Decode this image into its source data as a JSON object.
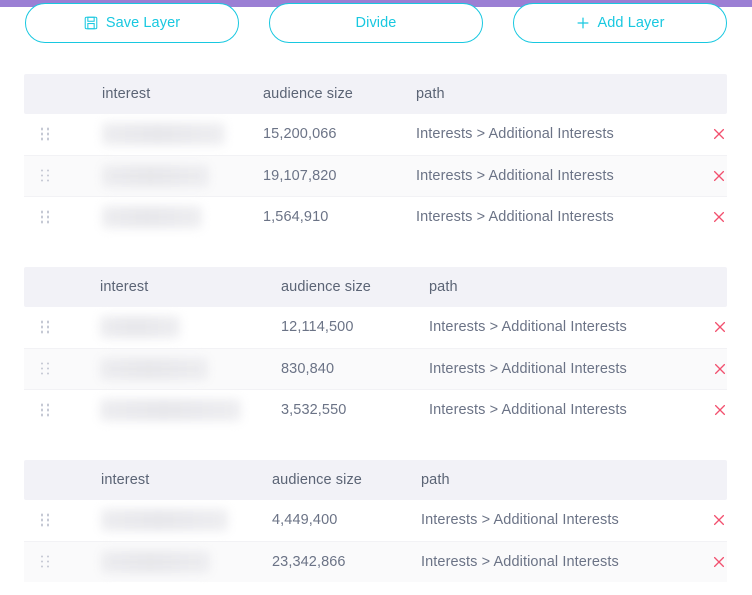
{
  "accent": {
    "top_bar_color": "#9b7fd4",
    "button_color": "#18c8e0",
    "delete_color": "#f2506e",
    "header_bg": "#f2f2f7"
  },
  "toolbar": {
    "save_label": "Save Layer",
    "save_icon": "save-icon",
    "divide_label": "Divide",
    "add_label": "Add Layer",
    "add_icon": "plus-icon"
  },
  "tables": [
    {
      "columns": {
        "interest": "interest",
        "audience": "audience size",
        "path": "path"
      },
      "col_x": {
        "interest": 78,
        "audience": 239,
        "path": 392,
        "delete": 686
      },
      "rows": [
        {
          "interest": "",
          "blur_width": 123,
          "audience": "15,200,066",
          "path": "Interests > Additional Interests",
          "delete_icon": "close-icon"
        },
        {
          "interest": "",
          "blur_width": 107,
          "audience": "19,107,820",
          "path": "Interests > Additional Interests",
          "delete_icon": "close-icon"
        },
        {
          "interest": "",
          "blur_width": 100,
          "audience": "1,564,910",
          "path": "Interests > Additional Interests",
          "delete_icon": "close-icon"
        }
      ]
    },
    {
      "columns": {
        "interest": "interest",
        "audience": "audience size",
        "path": "path"
      },
      "col_x": {
        "interest": 76,
        "audience": 257,
        "path": 405,
        "delete": 687
      },
      "rows": [
        {
          "interest": "",
          "blur_width": 80,
          "audience": "12,114,500",
          "path": "Interests > Additional Interests",
          "delete_icon": "close-icon"
        },
        {
          "interest": "",
          "blur_width": 108,
          "audience": "830,840",
          "path": "Interests > Additional Interests",
          "delete_icon": "close-icon"
        },
        {
          "interest": "",
          "blur_width": 141,
          "audience": "3,532,550",
          "path": "Interests > Additional Interests",
          "delete_icon": "close-icon"
        }
      ]
    },
    {
      "columns": {
        "interest": "interest",
        "audience": "audience size",
        "path": "path"
      },
      "col_x": {
        "interest": 77,
        "audience": 248,
        "path": 397,
        "delete": 686
      },
      "rows": [
        {
          "interest": "",
          "blur_width": 127,
          "audience": "4,449,400",
          "path": "Interests > Additional Interests",
          "delete_icon": "close-icon"
        },
        {
          "interest": "",
          "blur_width": 109,
          "audience": "23,342,866",
          "path": "Interests > Additional Interests",
          "delete_icon": "close-icon"
        }
      ]
    }
  ],
  "layout": {
    "table_tops": [
      74,
      267,
      460
    ]
  }
}
